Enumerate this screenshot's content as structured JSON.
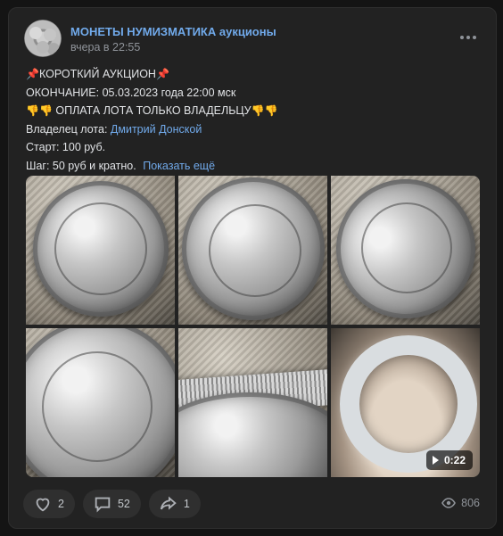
{
  "post": {
    "group_name": "МОНЕТЫ НУМИЗМАТИКА аукционы",
    "time": "вчера в 22:55",
    "lines": {
      "title": "КОРОТКИЙ АУКЦИОН",
      "ending": "ОКОНЧАНИЕ: 05.03.2023 года 22:00 мск",
      "payment": "ОПЛАТА ЛОТА ТОЛЬКО ВЛАДЕЛЬЦУ",
      "owner_label": "Владелец лота:",
      "owner_name": "Дмитрий Донской",
      "start": "Старт: 100 руб.",
      "step": "Шаг: 50 руб и кратно.",
      "show_more": "Показать ещё"
    },
    "emoji": {
      "pin": "📌",
      "point_down": "👎"
    },
    "video_duration": "0:22"
  },
  "footer": {
    "likes": "2",
    "comments": "52",
    "shares": "1",
    "views": "806"
  },
  "icons": {
    "more": "more-icon",
    "like": "heart-icon",
    "comment": "comment-icon",
    "share": "share-icon",
    "views": "eye-icon",
    "play": "play-icon"
  },
  "colors": {
    "background": "#141414",
    "card": "#222222",
    "link": "#71aaeb",
    "text": "#e1e3e6",
    "muted": "#8f9399"
  }
}
